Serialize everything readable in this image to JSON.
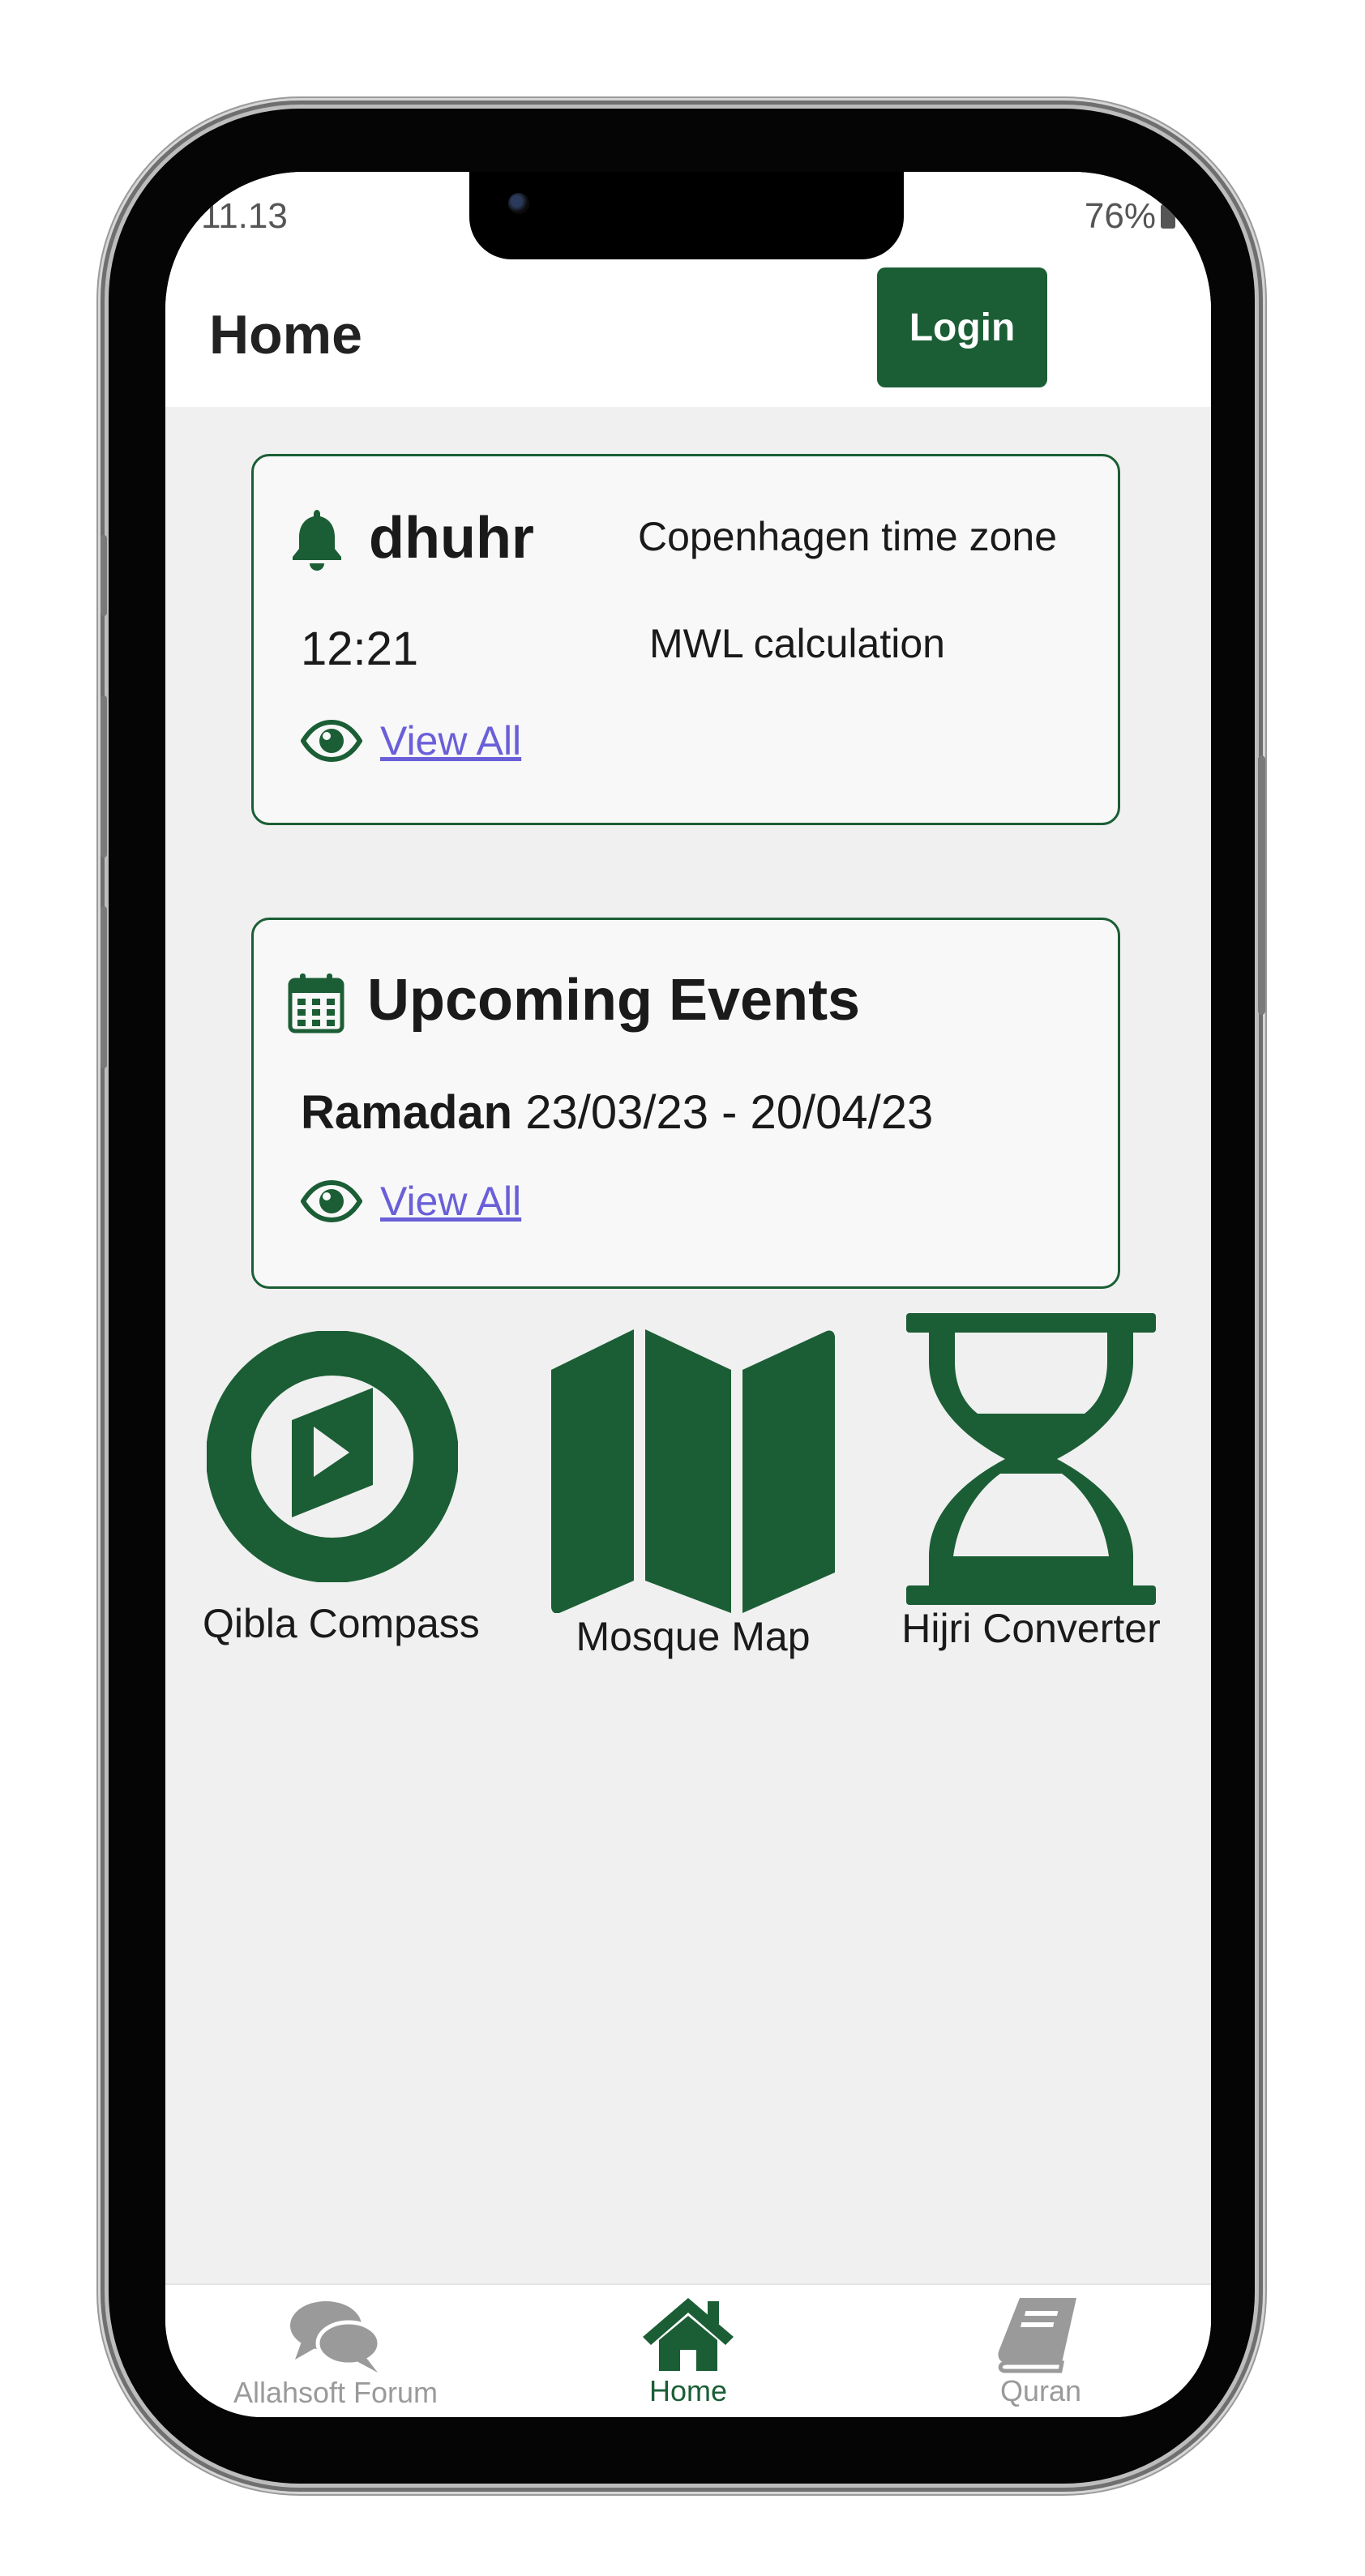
{
  "status_bar": {
    "time": "11.13",
    "battery": "76%"
  },
  "header": {
    "title": "Home",
    "login_label": "Login"
  },
  "prayer_card": {
    "prayer_name": "dhuhr",
    "timezone": "Copenhagen time zone",
    "time": "12:21",
    "calculation": "MWL calculation",
    "view_all": "View All"
  },
  "events_card": {
    "title": "Upcoming Events",
    "event_name": "Ramadan",
    "event_dates": "23/03/23 - 20/04/23",
    "view_all": "View All"
  },
  "features": [
    {
      "label": "Qibla Compass",
      "icon": "compass-icon"
    },
    {
      "label": "Mosque Map",
      "icon": "map-icon"
    },
    {
      "label": "Hijri Converter",
      "icon": "hourglass-icon"
    }
  ],
  "tabs": [
    {
      "label": "Allahsoft Forum",
      "icon": "comments-icon",
      "active": false
    },
    {
      "label": "Home",
      "icon": "home-icon",
      "active": true
    },
    {
      "label": "Quran",
      "icon": "book-icon",
      "active": false
    }
  ],
  "colors": {
    "brand": "#1b5e35",
    "link": "#6a5fd8",
    "background": "#f0f0f0",
    "inactive_tab": "#9a9a9a"
  }
}
